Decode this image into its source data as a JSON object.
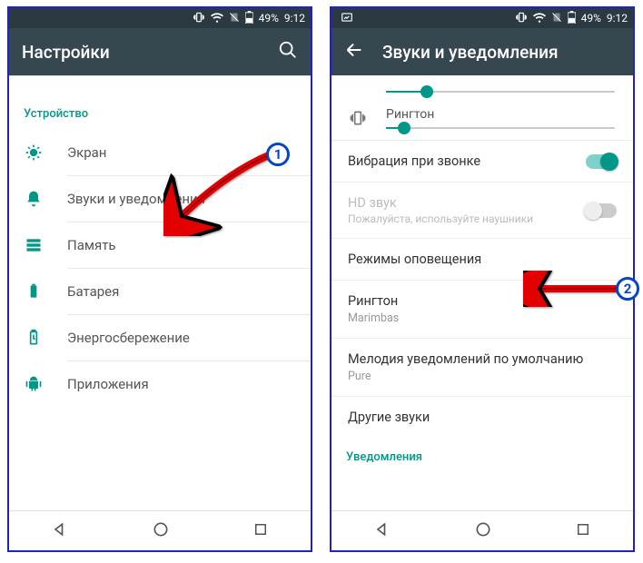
{
  "status": {
    "battery": "49%",
    "time": "9:12"
  },
  "left": {
    "title": "Настройки",
    "section": "Устройство",
    "items": [
      {
        "label": "Экран"
      },
      {
        "label": "Звуки и уведомления"
      },
      {
        "label": "Память"
      },
      {
        "label": "Батарея"
      },
      {
        "label": "Энергосбережение"
      },
      {
        "label": "Приложения"
      }
    ]
  },
  "right": {
    "title": "Звуки и уведомления",
    "ringtone_slider": "Рингтон",
    "vibrate": "Вибрация при звонке",
    "hd_title": "HD звук",
    "hd_sub": "Пожалуйста, используйте наушники",
    "modes": "Режимы оповещения",
    "ringtone_row": "Рингтон",
    "ringtone_value": "Marimbas",
    "notif_row": "Мелодия уведомлений по умолчанию",
    "notif_value": "Pure",
    "other": "Другие звуки",
    "notifications_section": "Уведомления"
  },
  "badges": {
    "one": "1",
    "two": "2"
  }
}
